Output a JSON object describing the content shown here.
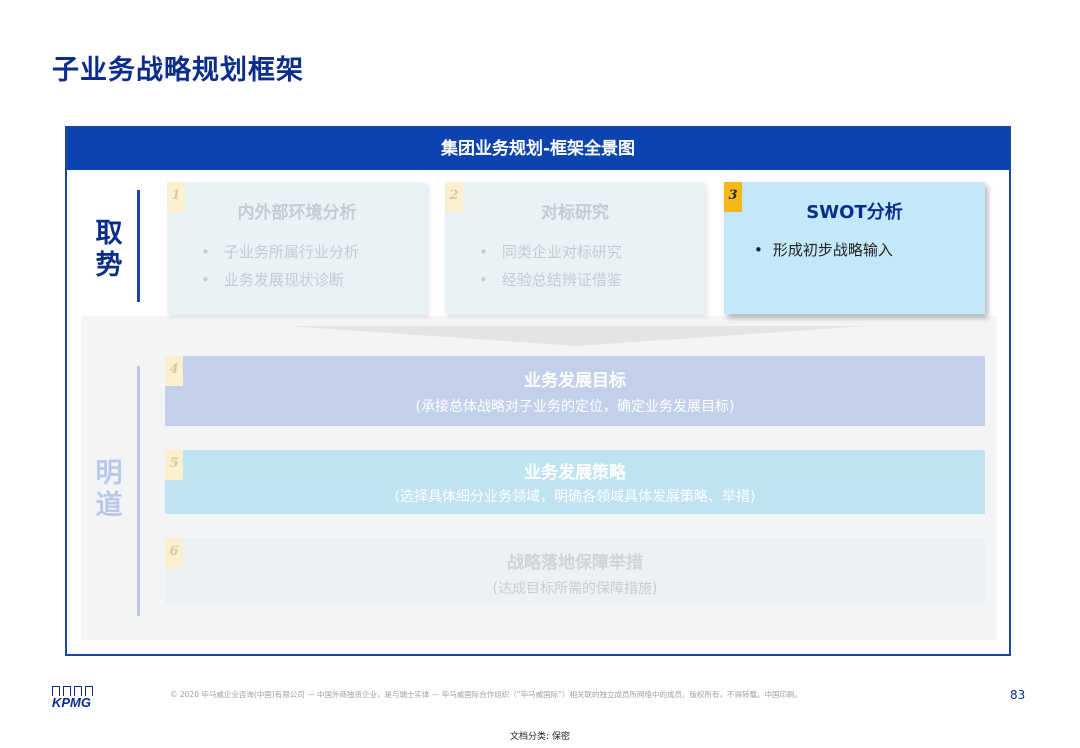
{
  "page": {
    "title": "子业务战略规划框架"
  },
  "frame": {
    "header": "集团业务规划-框架全景图",
    "side_labels": {
      "qushi": [
        "取",
        "势"
      ],
      "mingdao": [
        "明",
        "道"
      ]
    },
    "cards": [
      {
        "num": "1",
        "title": "内外部环境分析",
        "items": [
          "子业务所属行业分析",
          "业务发展现状诊断"
        ],
        "highlighted": false
      },
      {
        "num": "2",
        "title": "对标研究",
        "items": [
          "同类企业对标研究",
          "经验总结辨证借鉴"
        ],
        "highlighted": false
      },
      {
        "num": "3",
        "title": "SWOT分析",
        "items": [
          "形成初步战略输入"
        ],
        "highlighted": true
      }
    ],
    "bands": [
      {
        "num": "4",
        "title": "业务发展目标",
        "subtitle": "(承接总体战略对子业务的定位，确定业务发展目标)"
      },
      {
        "num": "5",
        "title": "业务发展策略",
        "subtitle": "(选择具体细分业务领域，明确各领域具体发展策略、举措)"
      },
      {
        "num": "6",
        "title": "战略落地保障举措",
        "subtitle": "(达成目标所需的保障措施)"
      }
    ]
  },
  "footer": {
    "logo": "KPMG",
    "copyright": "© 2020 毕马威企业咨询(中国)有限公司 — 中国外商独资企业，是与瑞士实体 — 毕马威国际合作组织（“毕马威国际”）相关联的独立成员所网络中的成员。版权所有，不得转载。中国印刷。",
    "page_number": "83",
    "doc_classification": "文档分类: 保密"
  },
  "colors": {
    "brand_dark_blue": "#0a2d8c",
    "header_blue": "#0b44b0",
    "highlight_card": "#c2e8fa",
    "number_tag_active": "#f4b81b"
  }
}
